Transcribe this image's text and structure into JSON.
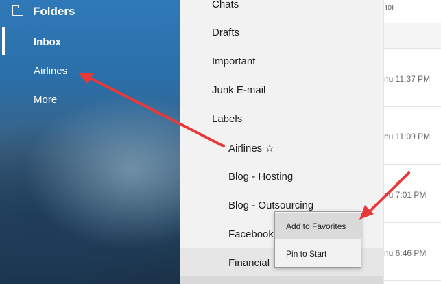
{
  "sidebar": {
    "header": "Folders",
    "items": [
      "Inbox",
      "Airlines",
      "More"
    ]
  },
  "folder_list": {
    "items": [
      "Chats",
      "Drafts",
      "Important",
      "Junk E-mail",
      "Labels"
    ],
    "sub_items": [
      "Airlines ☆",
      "Blog - Hosting",
      "Blog - Outsourcing",
      "Facebook",
      "Financial"
    ]
  },
  "message_list": {
    "top_fragment": "I",
    "fragment": "ıoı",
    "times": [
      "nu 11:37 PM",
      "nu 11:09 PM",
      "nu 7:01 PM",
      "nu 6:46 PM"
    ]
  },
  "context_menu": {
    "items": [
      "Add to Favorites",
      "Pin to Start"
    ]
  },
  "colors": {
    "annotation_arrow": "#e8393a",
    "sidebar_blue": "#2a6fa9"
  }
}
